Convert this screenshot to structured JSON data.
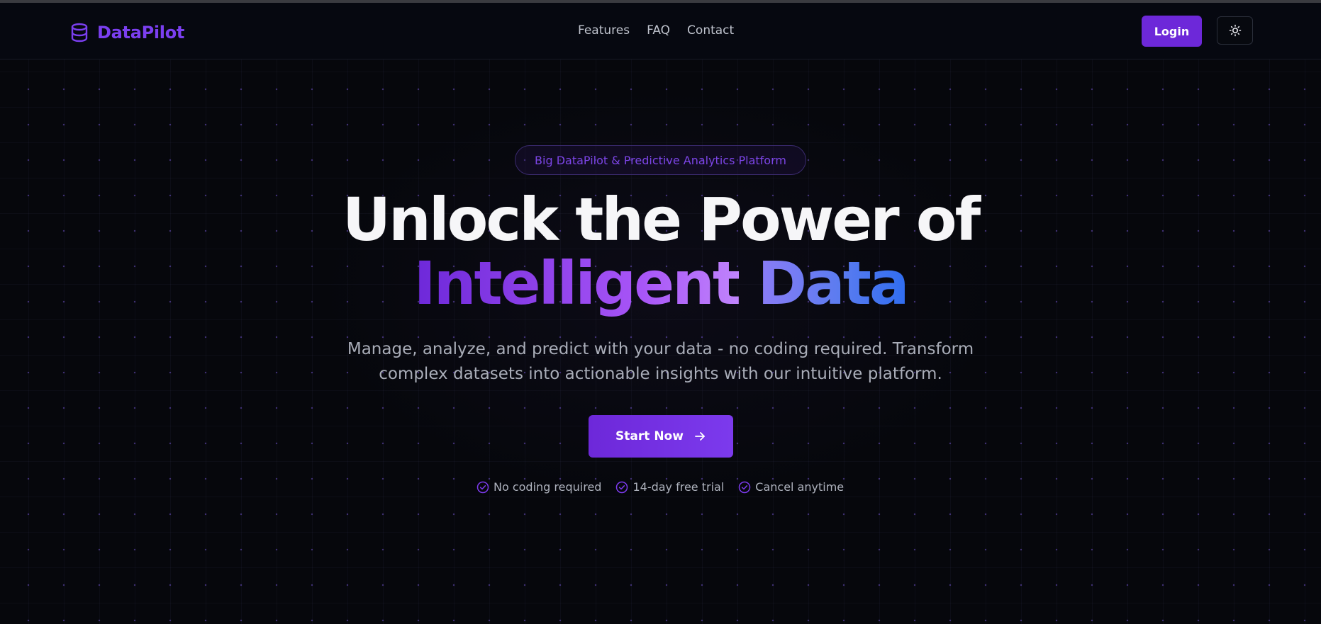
{
  "brand": {
    "name": "DataPilot",
    "icon": "database-icon",
    "color": "#7b3ff0"
  },
  "nav": {
    "links": [
      "Features",
      "FAQ",
      "Contact"
    ],
    "login_label": "Login",
    "theme_toggle_icon": "sun-icon"
  },
  "hero": {
    "badge": "Big DataPilot & Predictive Analytics Platform",
    "headline_line1": "Unlock the Power of",
    "headline_word1": "Intelligent",
    "headline_word2": "Data",
    "subtitle": "Manage, analyze, and predict with your data - no coding required. Transform complex datasets into actionable insights with our intuitive platform.",
    "cta_label": "Start Now",
    "cta_icon": "arrow-right-icon",
    "features": [
      {
        "label": "No coding required",
        "icon": "check-circle-icon"
      },
      {
        "label": "14-day free trial",
        "icon": "check-circle-icon"
      },
      {
        "label": "Cancel anytime",
        "icon": "check-circle-icon"
      }
    ]
  },
  "colors": {
    "accent": "#6d28d9",
    "background": "#06070c",
    "text_primary": "#f6f6f8",
    "text_muted": "#a9adb8"
  }
}
